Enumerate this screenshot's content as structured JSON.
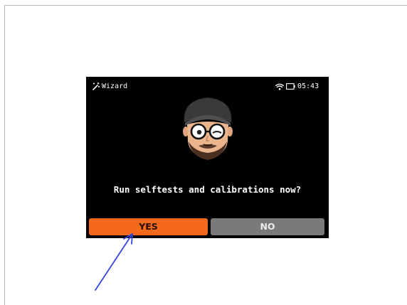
{
  "header": {
    "title": "Wizard",
    "time": "05:43",
    "icons": [
      "wizard-icon",
      "wifi-icon",
      "battery-icon"
    ]
  },
  "avatar": {
    "icon": "avatar-face-icon"
  },
  "dialog": {
    "prompt": "Run selftests and calibrations now?",
    "yes_label": "YES",
    "no_label": "NO"
  },
  "annotation": {
    "icon": "pointer-arrow-icon",
    "color": "#3346e0"
  },
  "colors": {
    "screen_background": "#000000",
    "yes_button": "#f36a1c",
    "no_button": "#7a7a7a",
    "header_text": "#ffffff"
  }
}
